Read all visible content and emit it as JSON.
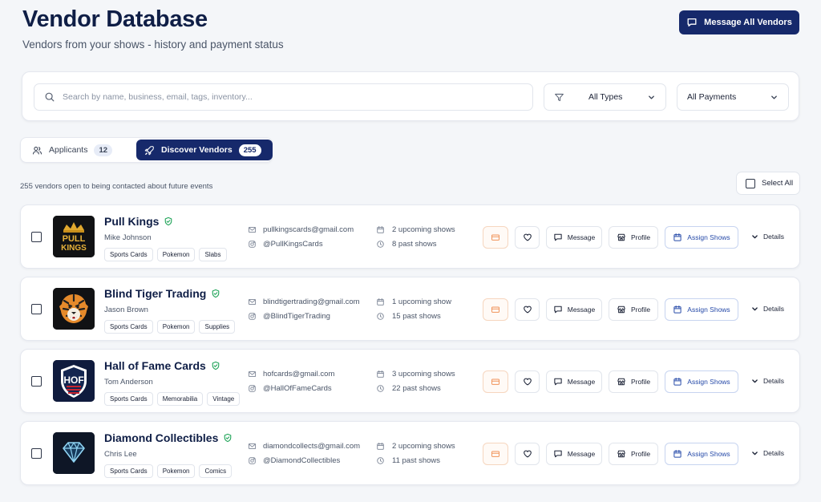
{
  "header": {
    "title": "Vendor Database",
    "subtitle": "Vendors from your shows - history and payment status",
    "message_all_label": "Message All Vendors"
  },
  "filters": {
    "search_placeholder": "Search by name, business, email, tags, inventory...",
    "type_value": "All Types",
    "payment_value": "All Payments"
  },
  "tabs": [
    {
      "label": "Applicants",
      "count": "12"
    },
    {
      "label": "Discover Vendors",
      "count": "255"
    }
  ],
  "list": {
    "summary": "255 vendors open to being contacted about future events",
    "select_all_label": "Select All"
  },
  "row_actions": {
    "message": "Message",
    "profile": "Profile",
    "assign": "Assign Shows",
    "details": "Details"
  },
  "vendors": [
    {
      "name": "Pull Kings",
      "owner": "Mike Johnson",
      "tags": [
        "Sports Cards",
        "Pokemon",
        "Slabs"
      ],
      "email": "pullkingscards@gmail.com",
      "instagram": "@PullKingsCards",
      "upcoming": "2 upcoming shows",
      "past": "8 past shows",
      "logo_text": [
        "PULL",
        "KINGS"
      ]
    },
    {
      "name": "Blind Tiger Trading",
      "owner": "Jason Brown",
      "tags": [
        "Sports Cards",
        "Pokemon",
        "Supplies"
      ],
      "email": "blindtigertrading@gmail.com",
      "instagram": "@BlindTigerTrading",
      "upcoming": "1 upcoming show",
      "past": "15 past shows"
    },
    {
      "name": "Hall of Fame Cards",
      "owner": "Tom Anderson",
      "tags": [
        "Sports Cards",
        "Memorabilia",
        "Vintage"
      ],
      "email": "hofcards@gmail.com",
      "instagram": "@HallOfFameCards",
      "upcoming": "3 upcoming shows",
      "past": "22 past shows",
      "logo_text": [
        "HOF"
      ]
    },
    {
      "name": "Diamond Collectibles",
      "owner": "Chris Lee",
      "tags": [
        "Sports Cards",
        "Pokemon",
        "Comics"
      ],
      "email": "diamondcollects@gmail.com",
      "instagram": "@DiamondCollectibles",
      "upcoming": "2 upcoming shows",
      "past": "11 past shows"
    }
  ],
  "colors": {
    "primary": "#16296b",
    "verified": "#22a55a",
    "payment_accent": "#f0935a",
    "assign_accent": "#2549a8"
  }
}
